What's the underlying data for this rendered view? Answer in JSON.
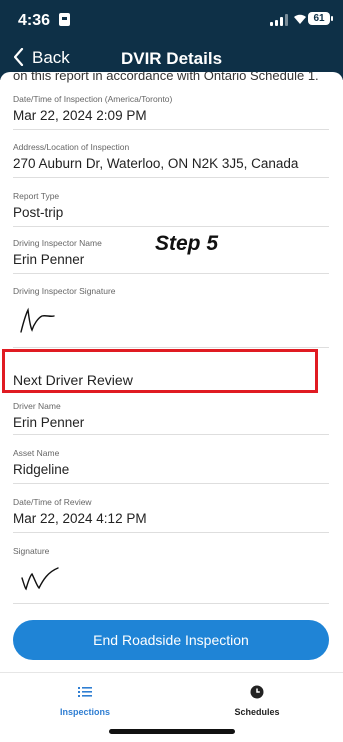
{
  "status_bar": {
    "time": "4:36",
    "battery": "61"
  },
  "nav": {
    "back_label": "Back",
    "title": "DVIR Details"
  },
  "cut_text": "on this report in accordance with Ontario Schedule 1.",
  "fields": {
    "date_inspection": {
      "label": "Date/Time of Inspection (America/Toronto)",
      "value": "Mar 22, 2024 2:09 PM"
    },
    "address": {
      "label": "Address/Location of Inspection",
      "value": "270 Auburn Dr, Waterloo, ON N2K 3J5, Canada"
    },
    "report_type": {
      "label": "Report Type",
      "value": "Post-trip"
    },
    "inspector_name": {
      "label": "Driving Inspector Name",
      "value": "Erin Penner"
    },
    "inspector_signature": {
      "label": "Driving Inspector Signature"
    },
    "driver_name": {
      "label": "Driver Name",
      "value": "Erin Penner"
    },
    "asset_name": {
      "label": "Asset Name",
      "value": "Ridgeline"
    },
    "date_review": {
      "label": "Date/Time of Review",
      "value": "Mar 22, 2024 4:12 PM"
    },
    "signature": {
      "label": "Signature"
    }
  },
  "section": {
    "next_driver_review": "Next Driver Review"
  },
  "annotation": {
    "step": "Step 5",
    "highlight_color": "#e01b22"
  },
  "buttons": {
    "end_roadside": "End Roadside Inspection"
  },
  "tabs": [
    {
      "label": "Inspections",
      "icon": "list-icon",
      "active": true
    },
    {
      "label": "Schedules",
      "icon": "clock-icon",
      "active": false
    }
  ],
  "colors": {
    "nav_bg": "#0e3047",
    "accent": "#1f84d6",
    "active_tab": "#2f7ed2"
  }
}
